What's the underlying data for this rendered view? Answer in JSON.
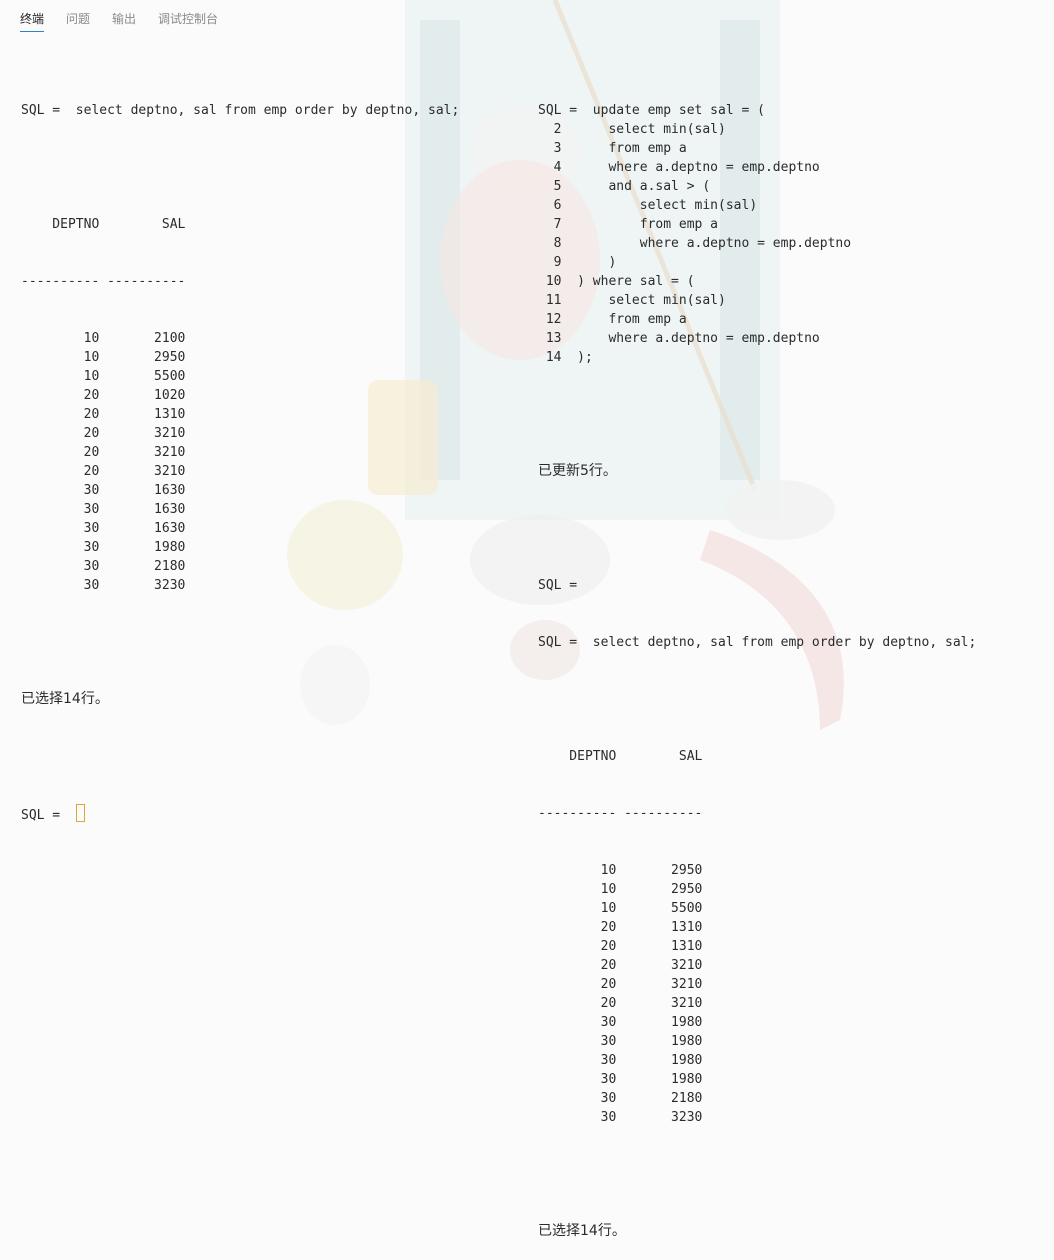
{
  "tabs": [
    "终端",
    "问题",
    "输出",
    "调试控制台"
  ],
  "active_tab": 0,
  "left": {
    "sql": "SQL =  select deptno, sal from emp order by deptno, sal;",
    "header": "    DEPTNO        SAL",
    "divider": "---------- ----------",
    "rows": [
      "        10       2100",
      "        10       2950",
      "        10       5500",
      "        20       1020",
      "        20       1310",
      "        20       3210",
      "        20       3210",
      "        20       3210",
      "        30       1630",
      "        30       1630",
      "        30       1630",
      "        30       1980",
      "        30       2180",
      "        30       3230"
    ],
    "result": "已选择14行。",
    "prompt": "SQL = "
  },
  "right": {
    "update_lines": [
      "SQL =  update emp set sal = (",
      "  2      select min(sal)",
      "  3      from emp a",
      "  4      where a.deptno = emp.deptno",
      "  5      and a.sal > (",
      "  6          select min(sal)",
      "  7          from emp a",
      "  8          where a.deptno = emp.deptno",
      "  9      )",
      " 10  ) where sal = (",
      " 11      select min(sal)",
      " 12      from emp a",
      " 13      where a.deptno = emp.deptno",
      " 14  );"
    ],
    "updated": "已更新5行。",
    "prompt_empty": "SQL =",
    "sql": "SQL =  select deptno, sal from emp order by deptno, sal;",
    "header": "    DEPTNO        SAL",
    "divider": "---------- ----------",
    "rows": [
      "        10       2950",
      "        10       2950",
      "        10       5500",
      "        20       1310",
      "        20       1310",
      "        20       3210",
      "        20       3210",
      "        20       3210",
      "        30       1980",
      "        30       1980",
      "        30       1980",
      "        30       1980",
      "        30       2180",
      "        30       3230"
    ],
    "result": "已选择14行。"
  }
}
